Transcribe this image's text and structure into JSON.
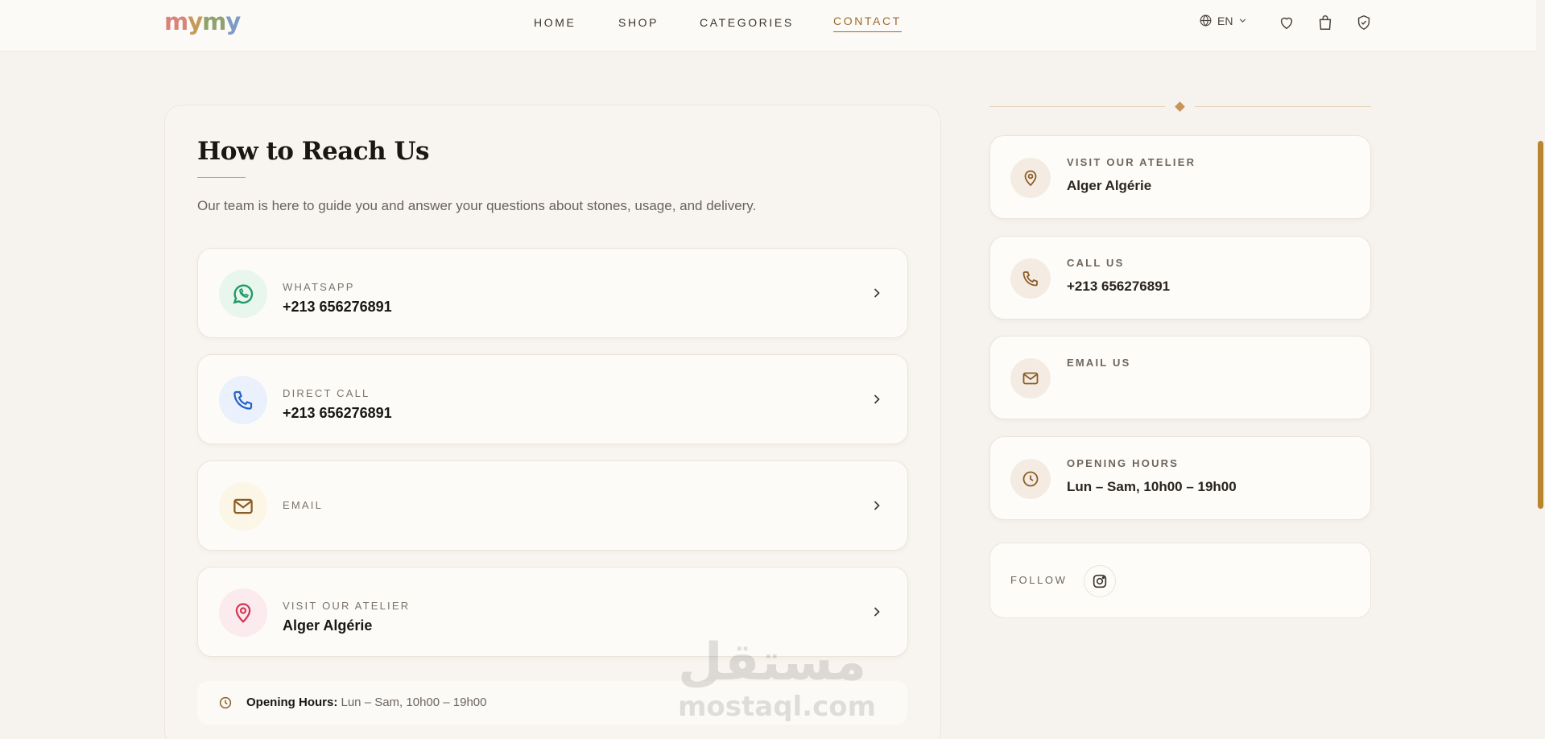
{
  "brand": {
    "logo_parts": [
      "m",
      "y",
      "m",
      "y"
    ]
  },
  "nav": {
    "items": [
      {
        "label": "HOME"
      },
      {
        "label": "SHOP"
      },
      {
        "label": "CATEGORIES"
      },
      {
        "label": "CONTACT",
        "active": true
      }
    ]
  },
  "header_actions": {
    "language": "EN"
  },
  "contact": {
    "title": "How to Reach Us",
    "subtitle": "Our team is here to guide you and answer your questions about stones, usage, and delivery.",
    "cards": [
      {
        "label": "WHATSAPP",
        "value": "+213 656276891",
        "icon": "whatsapp-icon"
      },
      {
        "label": "DIRECT CALL",
        "value": "+213 656276891",
        "icon": "phone-icon"
      },
      {
        "label": "EMAIL",
        "value": "",
        "icon": "mail-icon"
      },
      {
        "label": "VISIT OUR ATELIER",
        "value": "Alger Algérie",
        "icon": "location-pin-icon"
      }
    ],
    "hours_label": "Opening Hours:",
    "hours_value": "Lun – Sam, 10h00 – 19h00"
  },
  "sidebar": {
    "info_cards": [
      {
        "label": "VISIT OUR ATELIER",
        "value": "Alger Algérie",
        "icon": "location-pin-icon"
      },
      {
        "label": "CALL US",
        "value": "+213 656276891",
        "icon": "phone-icon"
      },
      {
        "label": "EMAIL US",
        "value": "",
        "icon": "mail-icon"
      },
      {
        "label": "OPENING HOURS",
        "value": "Lun – Sam, 10h00 – 19h00",
        "icon": "clock-icon"
      }
    ],
    "follow_label": "FOLLOW"
  },
  "watermark": {
    "arabic": "مستقل",
    "latin": "mostaql.com"
  },
  "colors": {
    "accent": "#9b6a2d",
    "whatsapp": "#1f9d64",
    "phone": "#2563c9",
    "pin": "#d63556",
    "background": "#f6f3ef",
    "scrollbar": "#b8862f"
  }
}
